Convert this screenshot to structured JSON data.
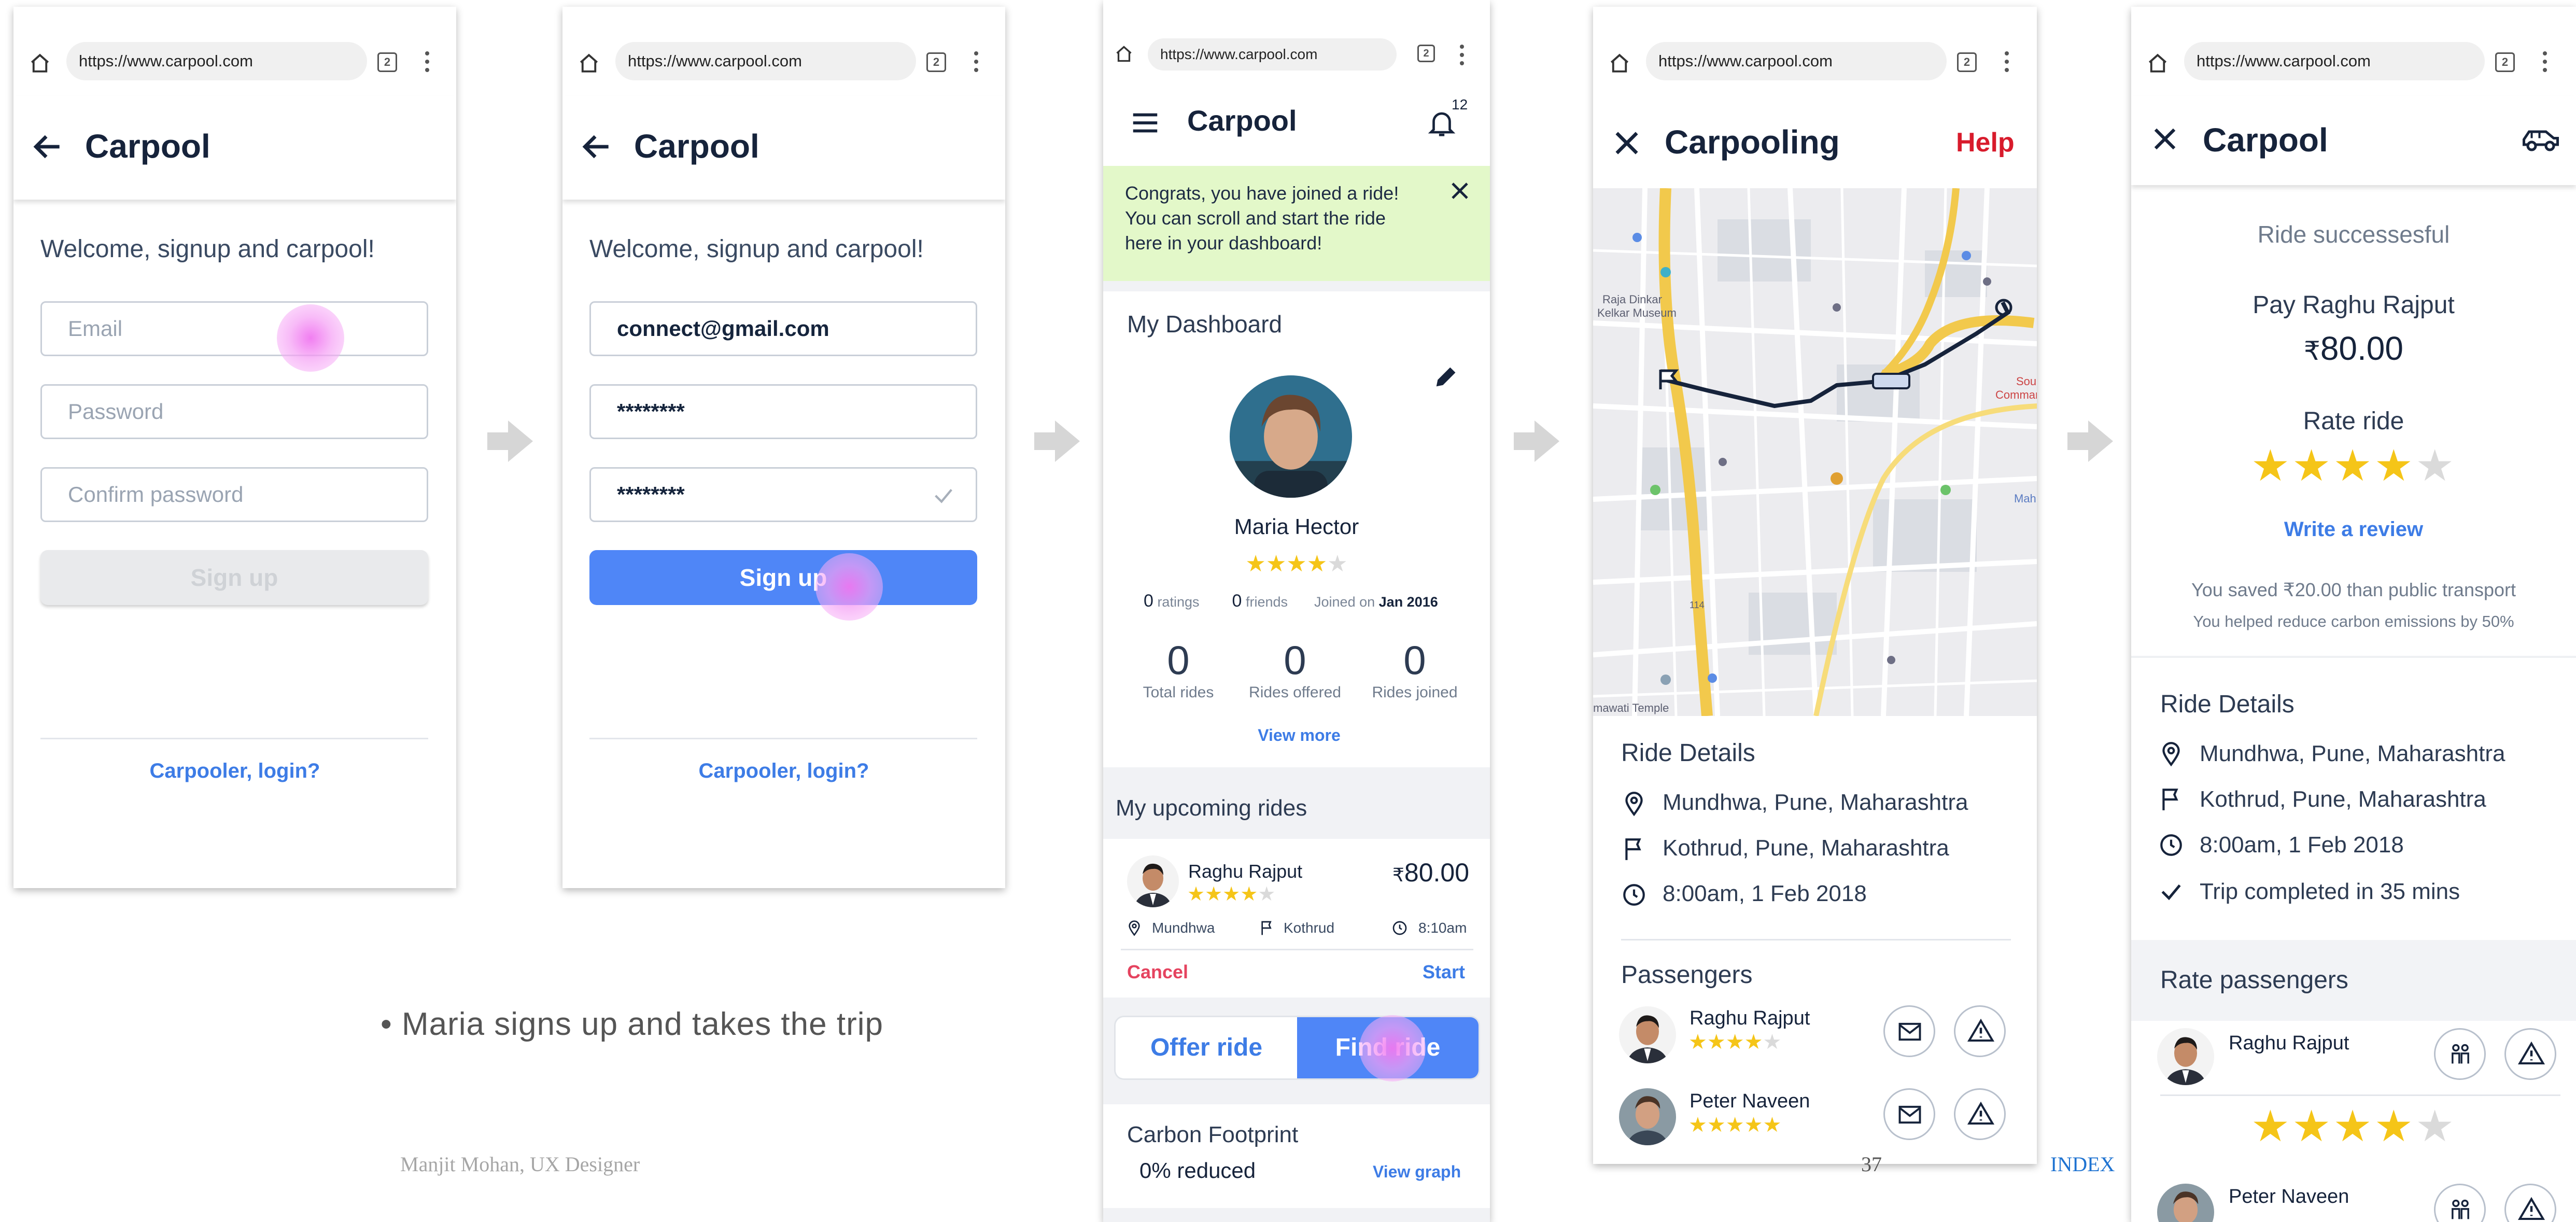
{
  "browser": {
    "url": "https://www.carpool.com",
    "tab_count": "2"
  },
  "screen1": {
    "title": "Carpool",
    "welcome": "Welcome, signup and carpool!",
    "email_placeholder": "Email",
    "password_placeholder": "Password",
    "confirm_placeholder": "Confirm password",
    "signup_label": "Sign up",
    "login_link": "Carpooler, login?"
  },
  "screen2": {
    "title": "Carpool",
    "welcome": "Welcome, signup and carpool!",
    "email_value": "connect@gmail.com",
    "password_value": "********",
    "confirm_value": "********",
    "signup_label": "Sign up",
    "login_link": "Carpooler, login?"
  },
  "screen3": {
    "title": "Carpool",
    "notification_count": "12",
    "banner": [
      "Congrats, you have joined a ride!",
      "You can scroll and start the ride",
      "here in your dashboard!"
    ],
    "dashboard_title": "My Dashboard",
    "user_name": "Maria Hector",
    "user_rating": 4,
    "ratings_count": "0",
    "ratings_label": "ratings",
    "friends_count": "0",
    "friends_label": "friends",
    "joined_label": "Joined on",
    "joined_date": "Jan 2016",
    "stats": [
      {
        "value": "0",
        "label": "Total rides"
      },
      {
        "value": "0",
        "label": "Rides offered"
      },
      {
        "value": "0",
        "label": "Rides joined"
      }
    ],
    "view_more": "View more",
    "upcoming_title": "My upcoming rides",
    "ride": {
      "driver": "Raghu Rajput",
      "rating": 4,
      "currency": "₹",
      "price": "80.00",
      "from": "Mundhwa",
      "to": "Kothrud",
      "time": "8:10am",
      "cancel": "Cancel",
      "start": "Start"
    },
    "offer_ride": "Offer ride",
    "find_ride": "Find ride",
    "carbon_title": "Carbon Footprint",
    "carbon_value": "0% reduced",
    "view_graph": "View graph"
  },
  "screen4": {
    "title": "Carpooling",
    "help": "Help",
    "map_labels": [
      "Raja Dinkar Kelkar Museum",
      "Sou",
      "Command Ho",
      "Mah",
      "mawati Temple",
      "114"
    ],
    "ride_details_title": "Ride Details",
    "from": "Mundhwa, Pune, Maharashtra",
    "to": "Kothrud, Pune, Maharashtra",
    "time": "8:00am, 1 Feb 2018",
    "passengers_title": "Passengers",
    "passengers": [
      {
        "name": "Raghu Rajput",
        "rating": 4
      },
      {
        "name": "Peter Naveen",
        "rating": 5
      }
    ]
  },
  "screen5": {
    "title": "Carpool",
    "success": "Ride successesful",
    "pay_label": "Pay Raghu Rajput",
    "currency": "₹",
    "amount": "80.00",
    "rate_label": "Rate ride",
    "rating": 4,
    "write_review": "Write a review",
    "saved_prefix": "You saved ",
    "saved_amount": "₹20.00",
    "saved_suffix": " than public transport",
    "carbon_note": "You helped reduce carbon emissions by 50%",
    "ride_details_title": "Ride Details",
    "from": "Mundhwa, Pune, Maharashtra",
    "to": "Kothrud, Pune, Maharashtra",
    "time": "8:00am, 1 Feb 2018",
    "completed": "Trip completed in 35 mins",
    "rate_passengers": "Rate passengers",
    "passengers": [
      {
        "name": "Raghu Rajput",
        "rating": 4
      },
      {
        "name": "Peter Naveen",
        "rating": 0
      }
    ]
  },
  "caption": "Maria signs up and takes the trip",
  "footer_credit": "Manjit Mohan, UX Designer",
  "page_number": "37",
  "index_link": "INDEX",
  "colors": {
    "primary": "#4f86f7",
    "navy": "#16233b",
    "banner": "#e3f8c9",
    "cancel": "#e5435f",
    "help": "#d81b2c",
    "star": "#f5c518"
  }
}
